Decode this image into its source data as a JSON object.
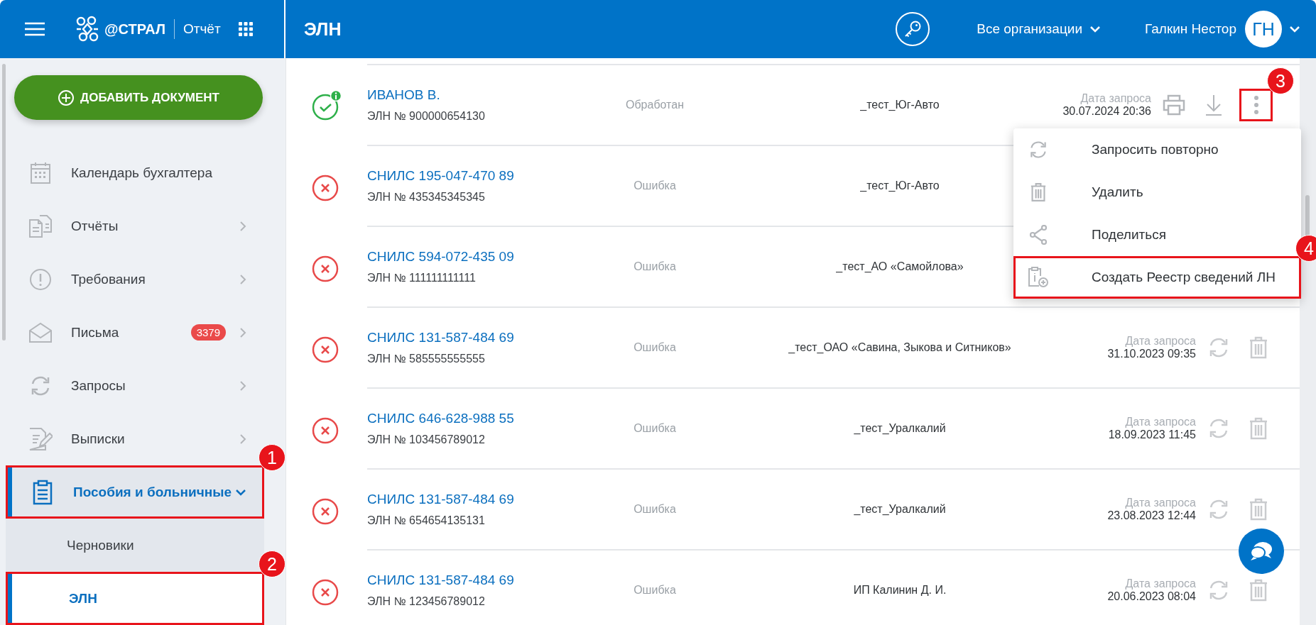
{
  "header": {
    "logo_text": "@СТРАЛ",
    "app_name": "Отчёт",
    "section_title": "ЭЛН",
    "org_selector": "Все организации",
    "user_name": "Галкин Нестор",
    "user_initials": "ГН"
  },
  "sidebar": {
    "add_button": "ДОБАВИТЬ ДОКУМЕНТ",
    "items": [
      {
        "label": "Календарь бухгалтера",
        "kind": "link",
        "selected": false
      },
      {
        "label": "Отчёты",
        "kind": "group",
        "selected": false,
        "expanded": false
      },
      {
        "label": "Требования",
        "kind": "group",
        "selected": false,
        "expanded": false
      },
      {
        "label": "Письма",
        "kind": "group",
        "selected": false,
        "expanded": false,
        "badge": "3379"
      },
      {
        "label": "Запросы",
        "kind": "group",
        "selected": false,
        "expanded": false
      },
      {
        "label": "Выписки",
        "kind": "group",
        "selected": false,
        "expanded": false
      },
      {
        "label": "Пособия и больничные",
        "kind": "group",
        "selected": true,
        "expanded": true,
        "annotation": "1",
        "children": [
          {
            "label": "Черновики",
            "selected": false
          },
          {
            "label": "ЭЛН",
            "selected": true,
            "annotation": "2"
          }
        ]
      }
    ]
  },
  "rows": [
    {
      "kind": "processed",
      "info": true,
      "title": "ИВАНОВ В.",
      "number": "ЭЛН № 900000654130",
      "state": "Обработан",
      "organization": "_тест_Юг-Авто",
      "date_label": "Дата запроса",
      "date": "30.07.2024 20:36",
      "annotation": "3"
    },
    {
      "kind": "error",
      "info": false,
      "title": "СНИЛС 195-047-470 89",
      "number": "ЭЛН № 435345345345",
      "state": "Ошибка",
      "organization": "_тест_Юг-Авто"
    },
    {
      "kind": "error",
      "info": false,
      "title": "СНИЛС 594-072-435 09",
      "number": "ЭЛН № 111111111111",
      "state": "Ошибка",
      "organization": "_тест_АО «Самойлова»"
    },
    {
      "kind": "error",
      "info": false,
      "title": "СНИЛС 131-587-484 69",
      "number": "ЭЛН № 585555555555",
      "state": "Ошибка",
      "organization": "_тест_ОАО «Савина, Зыкова и Ситников»",
      "date_label": "Дата запроса",
      "date": "31.10.2023 09:35"
    },
    {
      "kind": "error",
      "info": false,
      "title": "СНИЛС 646-628-988 55",
      "number": "ЭЛН № 103456789012",
      "state": "Ошибка",
      "organization": "_тест_Уралкалий",
      "date_label": "Дата запроса",
      "date": "18.09.2023 11:45"
    },
    {
      "kind": "error",
      "info": false,
      "title": "СНИЛС 131-587-484 69",
      "number": "ЭЛН № 654654135131",
      "state": "Ошибка",
      "organization": "_тест_Уралкалий",
      "date_label": "Дата запроса",
      "date": "23.08.2023 12:44"
    },
    {
      "kind": "error",
      "info": false,
      "title": "СНИЛС 131-587-484 69",
      "number": "ЭЛН № 123456789012",
      "state": "Ошибка",
      "organization": "ИП Калинин Д. И.",
      "date_label": "Дата запроса",
      "date": "20.06.2023 08:04"
    }
  ],
  "menu": {
    "items": [
      {
        "label": "Запросить повторно"
      },
      {
        "label": "Удалить"
      },
      {
        "label": "Поделиться"
      },
      {
        "label": "Создать Реестр сведений ЛН",
        "annotation": "4"
      }
    ]
  }
}
